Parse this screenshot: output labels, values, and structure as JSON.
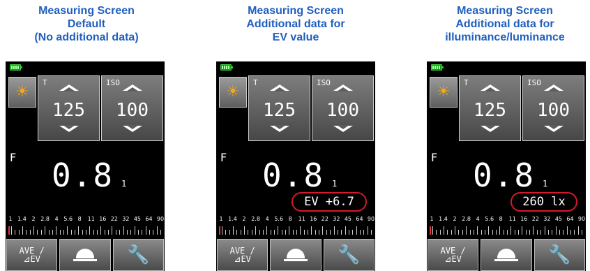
{
  "panels": [
    {
      "caption": [
        "Measuring Screen",
        "Default",
        "(No additional data)"
      ],
      "shutter_label": "T",
      "shutter_value": "125",
      "iso_label": "ISO",
      "iso_value": "100",
      "f_label": "F",
      "f_value": "0.8",
      "f_sub": "1",
      "extra": null,
      "scale": [
        "1",
        "1.4",
        "2",
        "2.8",
        "4",
        "5.6",
        "8",
        "11",
        "16",
        "22",
        "32",
        "45",
        "64",
        "90"
      ],
      "ave_label": "AVE /\n⊿EV"
    },
    {
      "caption": [
        "Measuring Screen",
        "Additional data for",
        "EV value"
      ],
      "shutter_label": "T",
      "shutter_value": "125",
      "iso_label": "ISO",
      "iso_value": "100",
      "f_label": "F",
      "f_value": "0.8",
      "f_sub": "1",
      "extra": "EV +6.7",
      "scale": [
        "1",
        "1.4",
        "2",
        "2.8",
        "4",
        "5.6",
        "8",
        "11",
        "16",
        "22",
        "32",
        "45",
        "64",
        "90"
      ],
      "ave_label": "AVE /\n⊿EV"
    },
    {
      "caption": [
        "Measuring Screen",
        "Additional data for",
        "illuminance/luminance"
      ],
      "shutter_label": "T",
      "shutter_value": "125",
      "iso_label": "ISO",
      "iso_value": "100",
      "f_label": "F",
      "f_value": "0.8",
      "f_sub": "1",
      "extra": "260 lx",
      "scale": [
        "1",
        "1.4",
        "2",
        "2.8",
        "4",
        "5.6",
        "8",
        "11",
        "16",
        "22",
        "32",
        "45",
        "64",
        "90"
      ],
      "ave_label": "AVE /\n⊿EV"
    }
  ],
  "icons": {
    "light_mode": "sun-icon",
    "dome": "dome-icon",
    "settings": "wrench-icon",
    "battery": "battery-icon"
  },
  "colors": {
    "caption": "#1f5fbf",
    "highlight_oval": "#d21a2a",
    "sun": "#f4a81a",
    "battery": "#3ad13a"
  }
}
